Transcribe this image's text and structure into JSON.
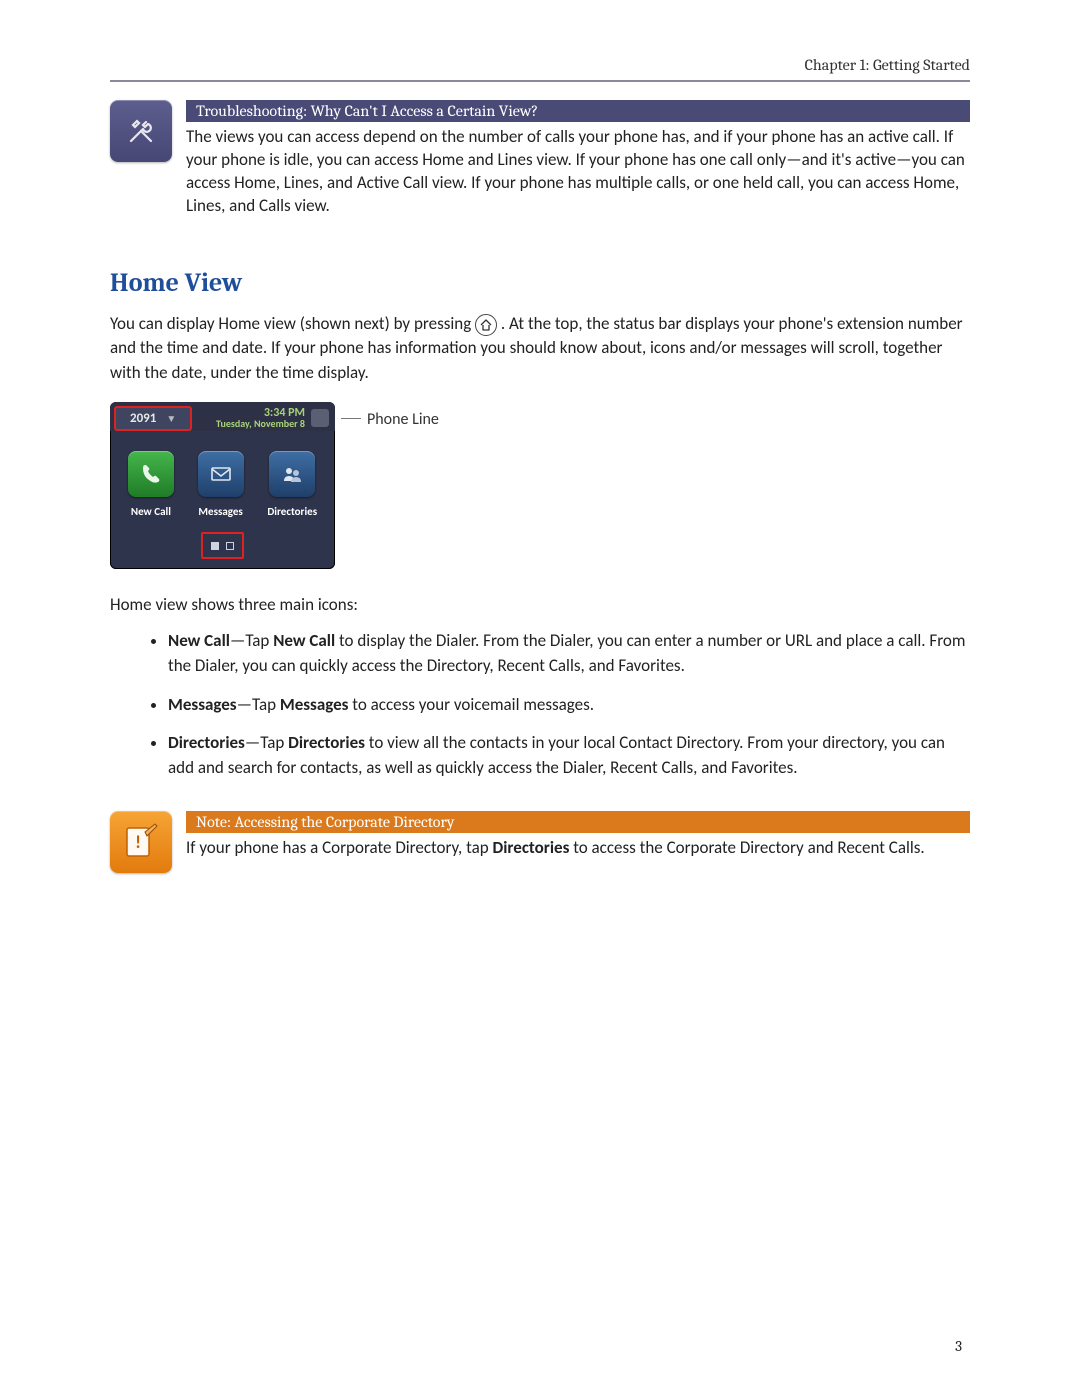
{
  "chapter_header": "Chapter 1: Getting Started",
  "troubleshooting": {
    "title": "Troubleshooting: Why Can't I Access a Certain View?",
    "text": "The views you can access depend on the number of calls your phone has, and if your phone has an active call. If your phone is idle, you can access Home and Lines view. If your phone has one call only—and it's active—you can access Home, Lines, and Active Call view. If your phone has multiple calls, or one held call, you can access Home, Lines, and Calls view."
  },
  "section_title": "Home View",
  "intro_before_icon": "You can display Home view (shown next) by pressing ",
  "intro_after_icon": ". At the top, the status bar displays your phone's extension number and the time and date. If your phone has information you should know about, icons and/or messages will scroll, together with the date, under the time display.",
  "phone": {
    "extension": "2091",
    "time": "3:34 PM",
    "date": "Tuesday, November 8",
    "apps": {
      "new_call": "New Call",
      "messages": "Messages",
      "directories": "Directories"
    },
    "callout_label": "Phone Line"
  },
  "list_intro": "Home view shows three main icons:",
  "bullets": {
    "new_call": {
      "term": "New Call",
      "dash": "—Tap ",
      "bold": "New Call",
      "rest": " to display the Dialer. From the Dialer, you can enter a number or URL and place a call. From the Dialer, you can quickly access the Directory, Recent Calls, and Favorites."
    },
    "messages": {
      "term": "Messages",
      "dash": "—Tap ",
      "bold": "Messages",
      "rest": " to access your voicemail messages."
    },
    "directories": {
      "term": "Directories",
      "dash": "—Tap ",
      "bold": "Directories",
      "rest": " to view all the contacts in your local Contact Directory. From your directory, you can add and search for contacts, as well as quickly access the Dialer, Recent Calls, and Favorites."
    }
  },
  "note": {
    "title": "Note: Accessing the Corporate Directory",
    "text_before": "If your phone has a Corporate Directory, tap ",
    "text_bold": "Directories",
    "text_after": " to access the Corporate Directory and Recent Calls."
  },
  "page_number": "3"
}
